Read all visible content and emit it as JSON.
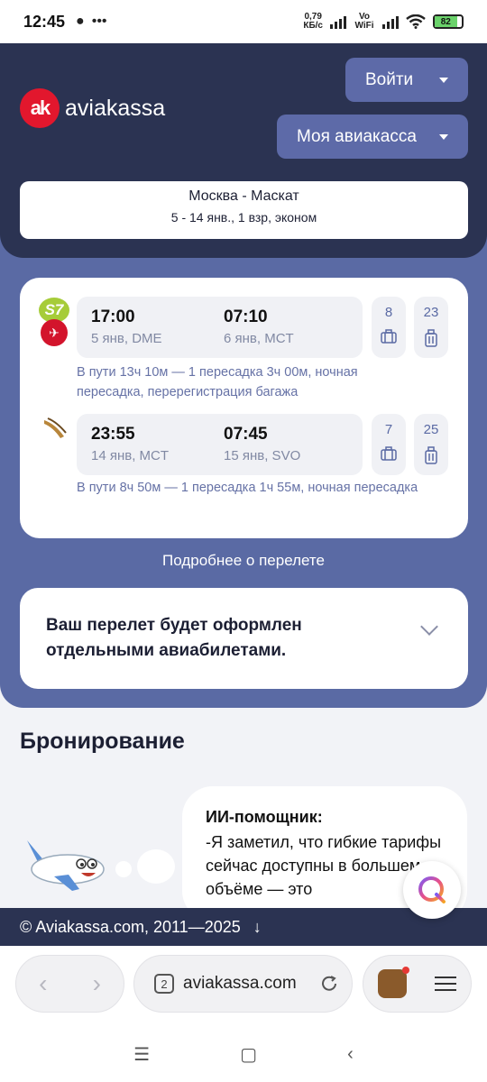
{
  "status": {
    "time": "12:45",
    "net_speed_value": "0,79",
    "net_speed_unit": "КБ/с",
    "vowifi": "Vo WiFi",
    "battery": "82"
  },
  "header": {
    "logo_mark": "ak",
    "logo_text": "aviakassa",
    "login_label": "Войти",
    "my_label": "Моя авиакасса",
    "route": "Москва - Маскат",
    "route_details": "5 - 14 янв., 1 взр, эконом"
  },
  "flights": [
    {
      "dep_time": "17:00",
      "dep_date": "5 янв, DME",
      "arr_time": "07:10",
      "arr_date": "6 янв, MCT",
      "baggage": "8",
      "carry_on": "23",
      "note": "В пути 13ч 10м — 1 пересадка 3ч 00м, ночная пересадка, перерегистрация багажа",
      "airlines": [
        "S7",
        "Turkish Airlines"
      ]
    },
    {
      "dep_time": "23:55",
      "dep_date": "14 янв, MCT",
      "arr_time": "07:45",
      "arr_date": "15 янв, SVO",
      "baggage": "7",
      "carry_on": "25",
      "note": "В пути 8ч 50м — 1 пересадка 1ч 55м, ночная пересадка",
      "airlines": [
        "Oman Air"
      ]
    }
  ],
  "details_link": "Подробнее о перелете",
  "warning": "Ваш перелет будет оформлен отдельными авиабилетами.",
  "booking": {
    "title": "Бронирование",
    "ai_title": "ИИ-помощник:",
    "ai_text": "-Я заметил, что гибкие тарифы сейчас доступны в большем объёме — это"
  },
  "footer": {
    "copyright": "© Aviakassa.com, 2011—2025",
    "arrow": "↓"
  },
  "browser": {
    "tab_count": "2",
    "url": "aviakassa.com"
  },
  "colors": {
    "header_bg": "#2b3352",
    "section_bg": "#5a6aa4",
    "brand_red": "#e2172d"
  }
}
